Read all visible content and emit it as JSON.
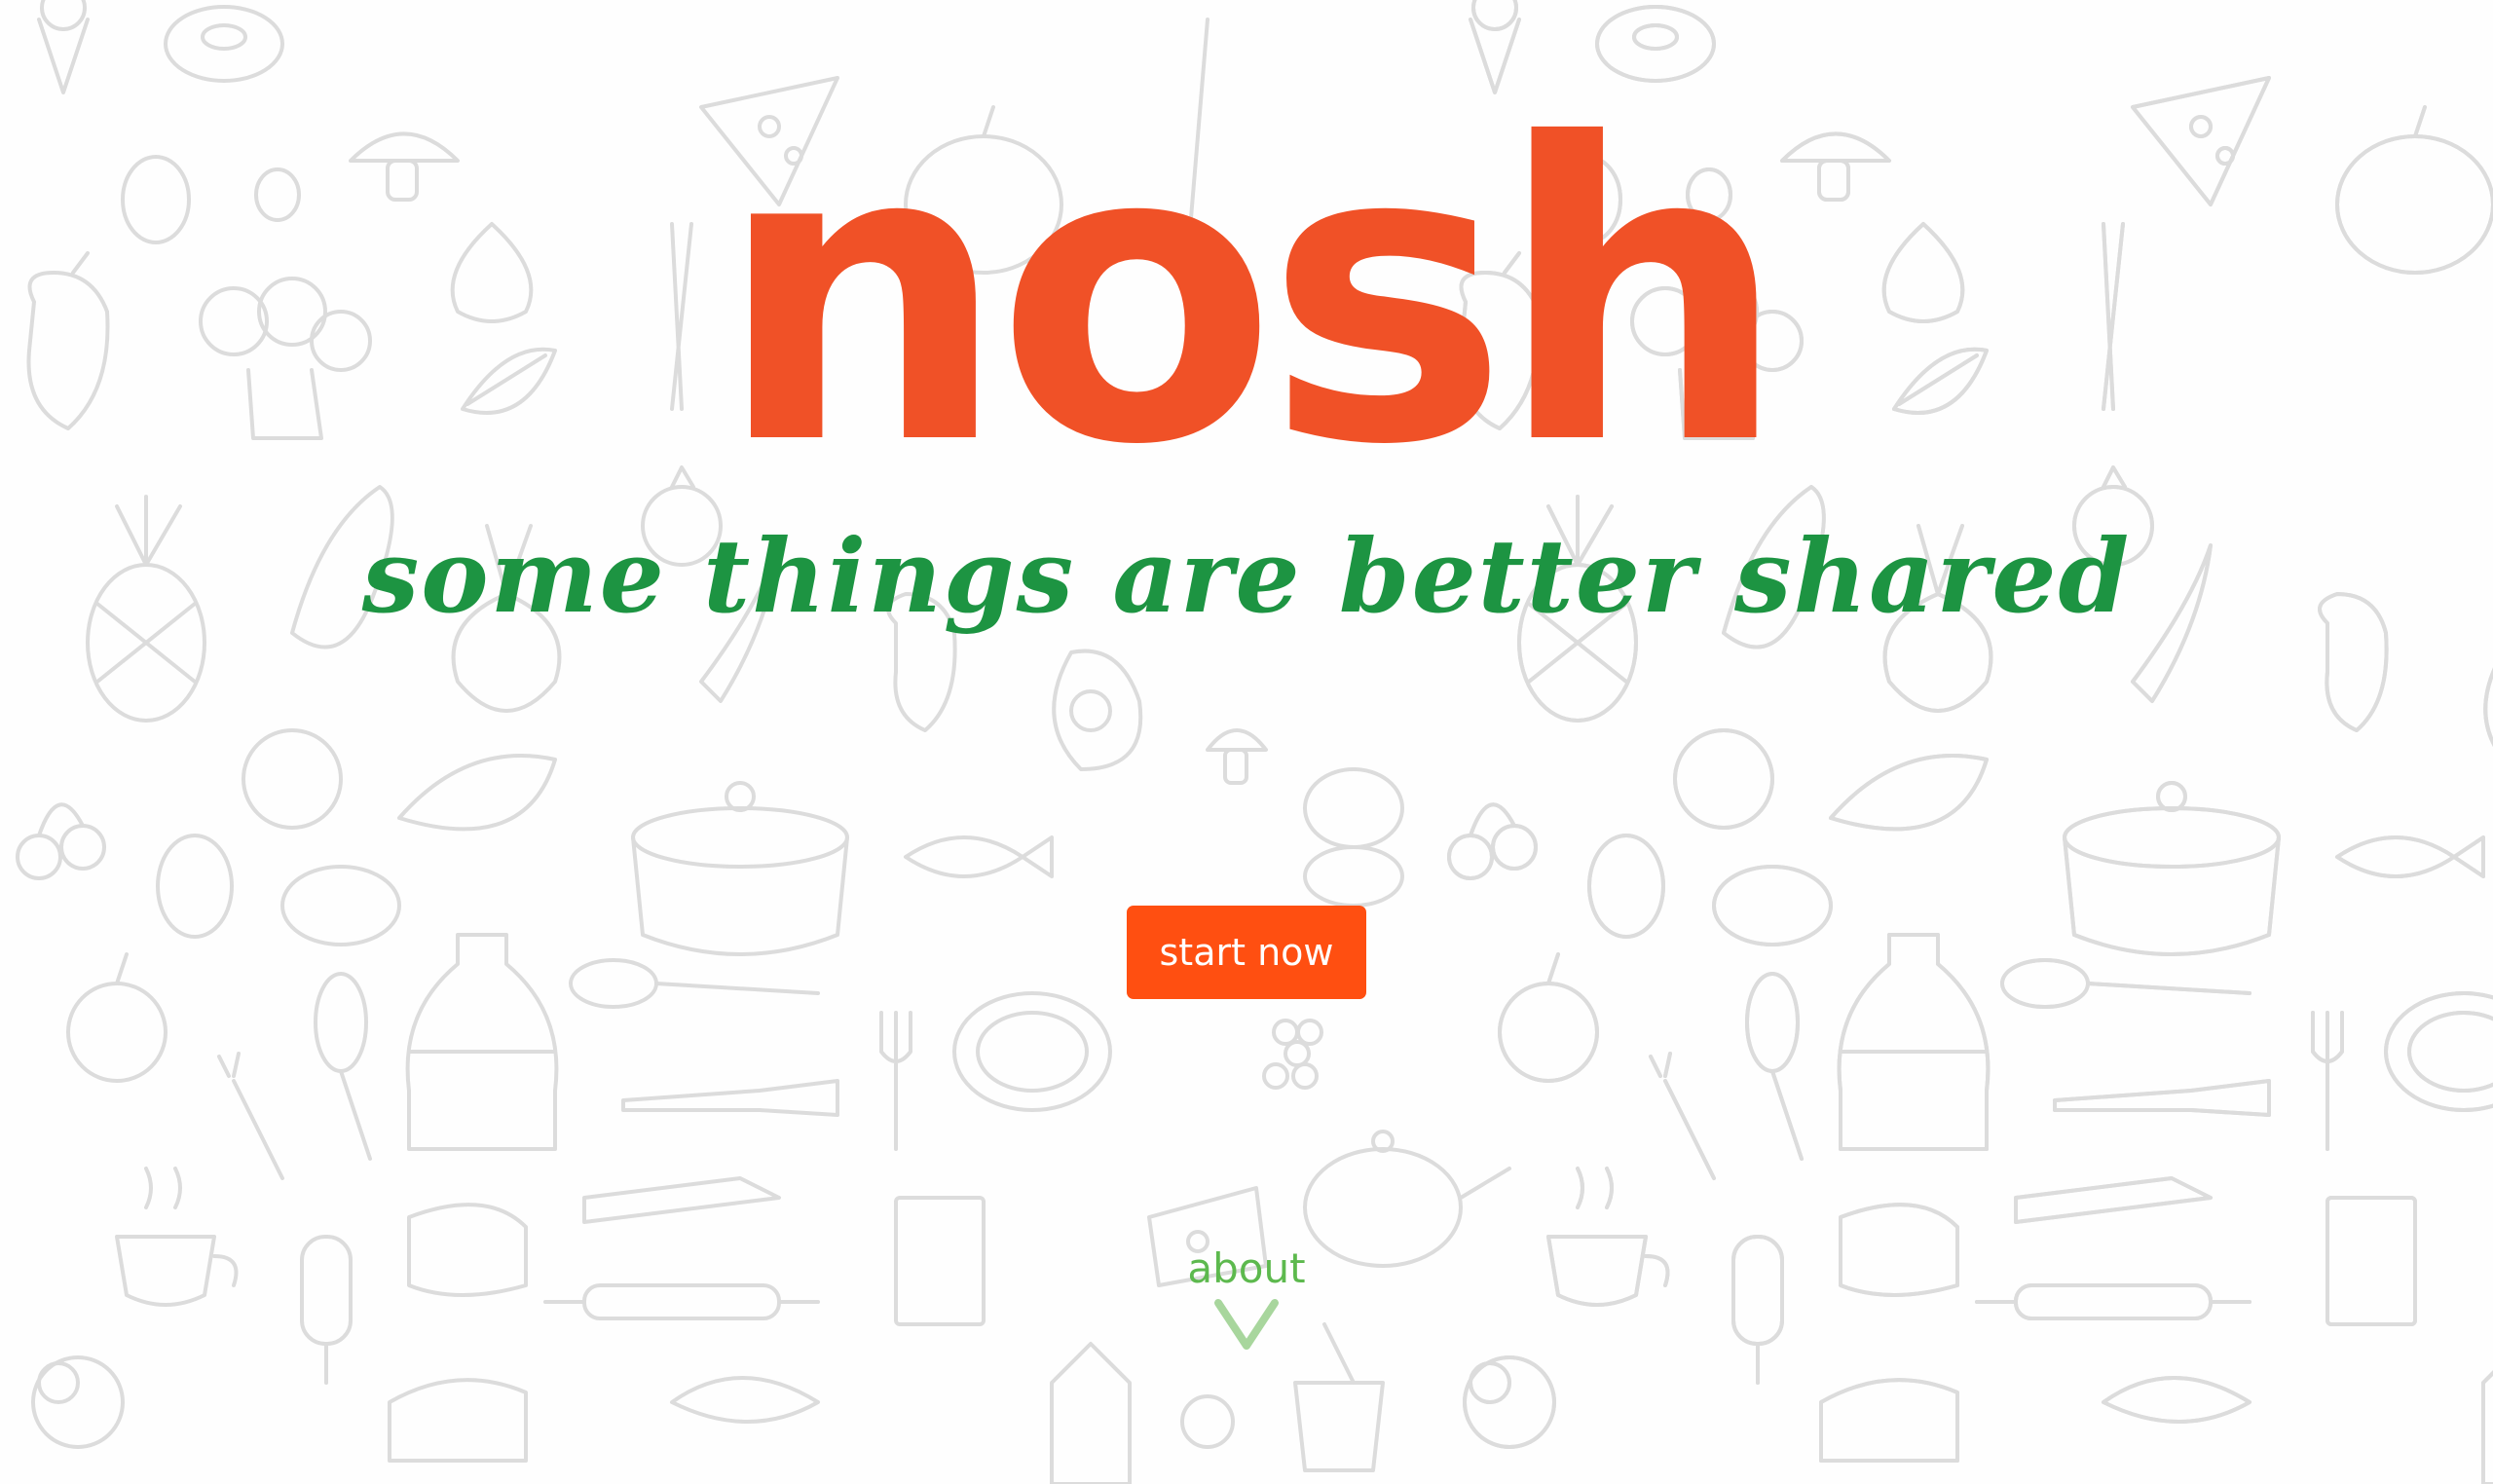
{
  "brand": {
    "logo_text": "nosh",
    "tagline": "some things are better shared"
  },
  "actions": {
    "start_label": "start now",
    "about_label": "about"
  },
  "icons": {
    "scroll_indicator": "chevron-down-icon",
    "background": "food-doodle-pattern"
  },
  "colors": {
    "logo": "#F05127",
    "tagline": "#1D9442",
    "button": "#FF4F11",
    "about": "#5DB94E",
    "doodles": "#DCDCDC"
  }
}
